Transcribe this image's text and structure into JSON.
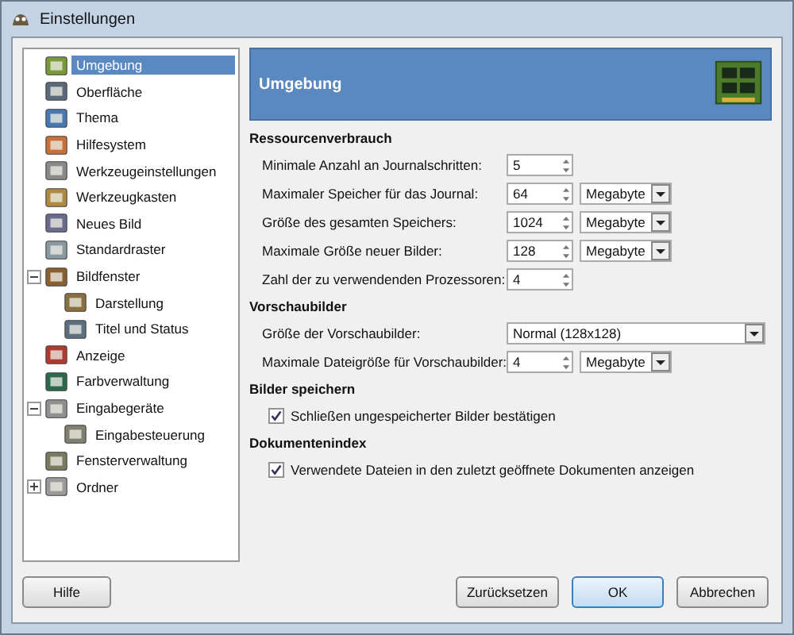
{
  "window": {
    "title": "Einstellungen"
  },
  "sidebar": {
    "items": [
      {
        "label": "Umgebung",
        "selected": true
      },
      {
        "label": "Oberfläche",
        "selected": false
      },
      {
        "label": "Thema",
        "selected": false
      },
      {
        "label": "Hilfesystem",
        "selected": false
      },
      {
        "label": "Werkzeugeinstellungen",
        "selected": false
      },
      {
        "label": "Werkzeugkasten",
        "selected": false
      },
      {
        "label": "Neues Bild",
        "selected": false
      },
      {
        "label": "Standardraster",
        "selected": false
      },
      {
        "label": "Bildfenster",
        "selected": false,
        "expanded": true,
        "children": [
          {
            "label": "Darstellung",
            "selected": false
          },
          {
            "label": "Titel und Status",
            "selected": false
          }
        ]
      },
      {
        "label": "Anzeige",
        "selected": false
      },
      {
        "label": "Farbverwaltung",
        "selected": false
      },
      {
        "label": "Eingabegeräte",
        "selected": false,
        "expanded": true,
        "children": [
          {
            "label": "Eingabesteuerung",
            "selected": false
          }
        ]
      },
      {
        "label": "Fensterverwaltung",
        "selected": false
      },
      {
        "label": "Ordner",
        "selected": false,
        "expanded": false
      }
    ]
  },
  "header": {
    "title": "Umgebung"
  },
  "sections": [
    {
      "title": "Ressourcenverbrauch",
      "rows": [
        {
          "kind": "spin",
          "label": "Minimale Anzahl an Journalschritten:",
          "value": "5"
        },
        {
          "kind": "spin",
          "label": "Maximaler Speicher für das Journal:",
          "value": "64",
          "unit": "Megabyte"
        },
        {
          "kind": "spin",
          "label": "Größe des gesamten Speichers:",
          "value": "1024",
          "unit": "Megabyte"
        },
        {
          "kind": "spin",
          "label": "Maximale Größe neuer Bilder:",
          "value": "128",
          "unit": "Megabyte"
        },
        {
          "kind": "spin",
          "label": "Zahl der zu verwendenden Prozessoren:",
          "value": "4"
        }
      ]
    },
    {
      "title": "Vorschaubilder",
      "rows": [
        {
          "kind": "select",
          "label": "Größe der Vorschaubilder:",
          "value": "Normal (128x128)"
        },
        {
          "kind": "spin",
          "label": "Maximale Dateigröße für Vorschaubilder:",
          "value": "4",
          "unit": "Megabyte"
        }
      ]
    },
    {
      "title": "Bilder speichern",
      "rows": [
        {
          "kind": "check",
          "label": "Schließen ungespeicherter Bilder bestätigen",
          "checked": true
        }
      ]
    },
    {
      "title": "Dokumentenindex",
      "rows": [
        {
          "kind": "check",
          "label": "Verwendete Dateien in den zuletzt geöffnete Dokumenten anzeigen",
          "checked": true
        }
      ]
    }
  ],
  "buttons": {
    "help": "Hilfe",
    "actions": [
      "Zurücksetzen",
      "OK",
      "Abbrechen"
    ]
  }
}
